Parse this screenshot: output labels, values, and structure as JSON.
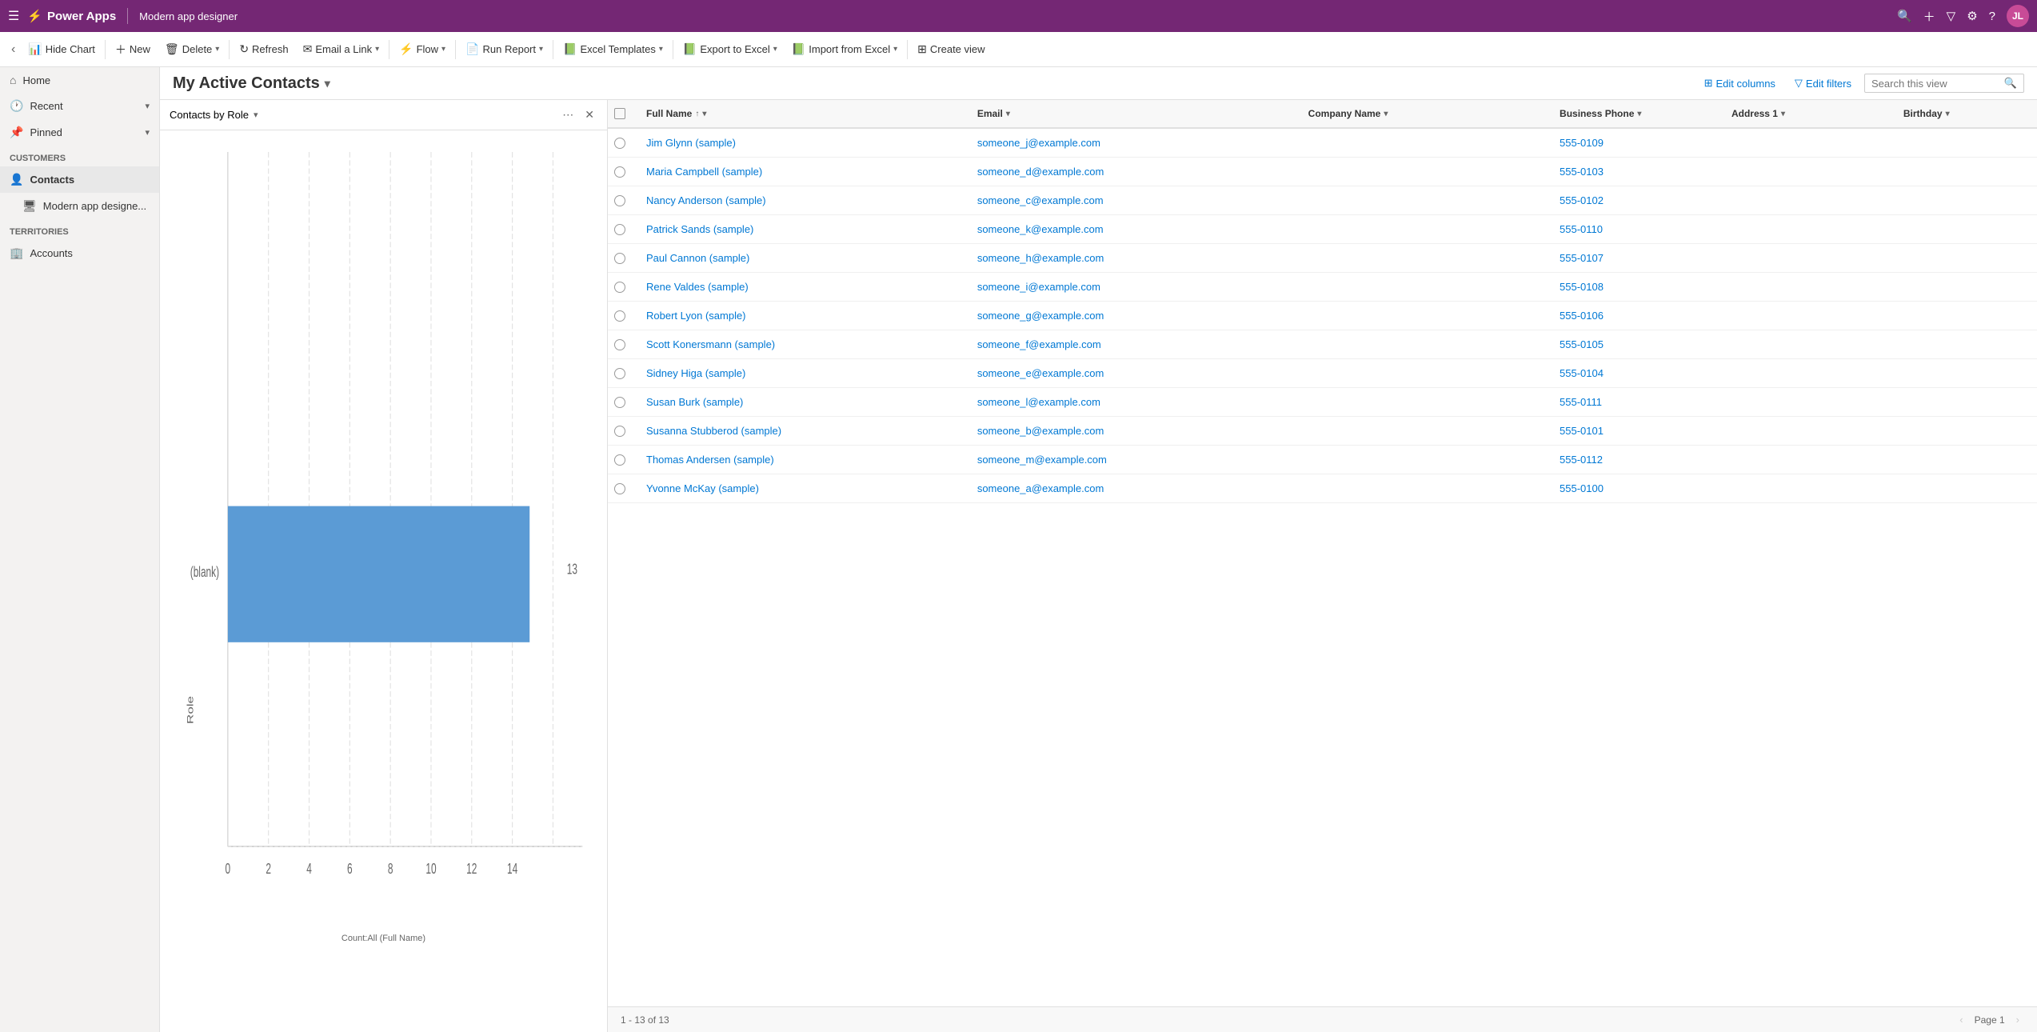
{
  "topbar": {
    "hamburger": "☰",
    "logo_icon": "⚡",
    "logo_text": "Power Apps",
    "app_name": "Modern app designer",
    "icons": [
      "🔍",
      "+",
      "▽",
      "⚙",
      "?"
    ],
    "avatar": "JL"
  },
  "commandbar": {
    "back_arrow": "‹",
    "buttons": [
      {
        "id": "hide-chart",
        "icon": "📊",
        "label": "Hide Chart",
        "has_dropdown": false
      },
      {
        "id": "new",
        "icon": "+",
        "label": "New",
        "has_dropdown": false
      },
      {
        "id": "delete",
        "icon": "🗑",
        "label": "Delete",
        "has_dropdown": true
      },
      {
        "id": "refresh",
        "icon": "↻",
        "label": "Refresh",
        "has_dropdown": false
      },
      {
        "id": "email-link",
        "icon": "✉",
        "label": "Email a Link",
        "has_dropdown": true
      },
      {
        "id": "flow",
        "icon": "⚡",
        "label": "Flow",
        "has_dropdown": true
      },
      {
        "id": "run-report",
        "icon": "📄",
        "label": "Run Report",
        "has_dropdown": true
      },
      {
        "id": "excel-templates",
        "icon": "📗",
        "label": "Excel Templates",
        "has_dropdown": true
      },
      {
        "id": "export-excel",
        "icon": "📗",
        "label": "Export to Excel",
        "has_dropdown": true
      },
      {
        "id": "import-excel",
        "icon": "📗",
        "label": "Import from Excel",
        "has_dropdown": true
      },
      {
        "id": "create-view",
        "icon": "⊞",
        "label": "Create view",
        "has_dropdown": false
      }
    ]
  },
  "view_header": {
    "title": "My Active Contacts",
    "title_dropdown": "▾",
    "edit_columns_label": "Edit columns",
    "edit_filters_label": "Edit filters",
    "search_placeholder": "Search this view",
    "search_icon": "🔍"
  },
  "chart_panel": {
    "title": "Contacts by Role",
    "title_dropdown": "▾",
    "more_icon": "⋯",
    "close_icon": "✕",
    "bar_data": [
      {
        "label": "(blank)",
        "value": 13,
        "color": "#5b9bd5"
      }
    ],
    "x_axis_label": "Count:All (Full Name)",
    "y_axis_label": "Role",
    "x_max": 14,
    "x_ticks": [
      0,
      2,
      4,
      6,
      8,
      10,
      12,
      14
    ]
  },
  "grid": {
    "columns": [
      {
        "id": "checkbox",
        "label": ""
      },
      {
        "id": "fullname",
        "label": "Full Name",
        "sort": "↑"
      },
      {
        "id": "email",
        "label": "Email",
        "sort": "↓"
      },
      {
        "id": "company",
        "label": "Company Name",
        "sort": "↓"
      },
      {
        "id": "phone",
        "label": "Business Phone",
        "sort": "↓"
      },
      {
        "id": "address",
        "label": "Address 1",
        "sort": "↓"
      },
      {
        "id": "birthday",
        "label": "Birthday",
        "sort": "↓"
      }
    ],
    "rows": [
      {
        "fullname": "Jim Glynn (sample)",
        "email": "someone_j@example.com",
        "company": "",
        "phone": "555-0109",
        "address": "",
        "birthday": ""
      },
      {
        "fullname": "Maria Campbell (sample)",
        "email": "someone_d@example.com",
        "company": "",
        "phone": "555-0103",
        "address": "",
        "birthday": ""
      },
      {
        "fullname": "Nancy Anderson (sample)",
        "email": "someone_c@example.com",
        "company": "",
        "phone": "555-0102",
        "address": "",
        "birthday": ""
      },
      {
        "fullname": "Patrick Sands (sample)",
        "email": "someone_k@example.com",
        "company": "",
        "phone": "555-0110",
        "address": "",
        "birthday": ""
      },
      {
        "fullname": "Paul Cannon (sample)",
        "email": "someone_h@example.com",
        "company": "",
        "phone": "555-0107",
        "address": "",
        "birthday": ""
      },
      {
        "fullname": "Rene Valdes (sample)",
        "email": "someone_i@example.com",
        "company": "",
        "phone": "555-0108",
        "address": "",
        "birthday": ""
      },
      {
        "fullname": "Robert Lyon (sample)",
        "email": "someone_g@example.com",
        "company": "",
        "phone": "555-0106",
        "address": "",
        "birthday": ""
      },
      {
        "fullname": "Scott Konersmann (sample)",
        "email": "someone_f@example.com",
        "company": "",
        "phone": "555-0105",
        "address": "",
        "birthday": ""
      },
      {
        "fullname": "Sidney Higa (sample)",
        "email": "someone_e@example.com",
        "company": "",
        "phone": "555-0104",
        "address": "",
        "birthday": ""
      },
      {
        "fullname": "Susan Burk (sample)",
        "email": "someone_l@example.com",
        "company": "",
        "phone": "555-0111",
        "address": "",
        "birthday": ""
      },
      {
        "fullname": "Susanna Stubberod (sample)",
        "email": "someone_b@example.com",
        "company": "",
        "phone": "555-0101",
        "address": "",
        "birthday": ""
      },
      {
        "fullname": "Thomas Andersen (sample)",
        "email": "someone_m@example.com",
        "company": "",
        "phone": "555-0112",
        "address": "",
        "birthday": ""
      },
      {
        "fullname": "Yvonne McKay (sample)",
        "email": "someone_a@example.com",
        "company": "",
        "phone": "555-0100",
        "address": "",
        "birthday": ""
      }
    ],
    "footer": {
      "record_count": "1 - 13 of 13",
      "page_label": "Page 1"
    }
  },
  "sidebar": {
    "sections": [
      {
        "id": "nav",
        "items": [
          {
            "id": "home",
            "icon": "⌂",
            "label": "Home",
            "has_expand": false
          },
          {
            "id": "recent",
            "icon": "🕐",
            "label": "Recent",
            "has_expand": true
          },
          {
            "id": "pinned",
            "icon": "📌",
            "label": "Pinned",
            "has_expand": true
          }
        ]
      },
      {
        "id": "customers",
        "header": "Customers",
        "items": [
          {
            "id": "contacts",
            "icon": "👤",
            "label": "Contacts",
            "active": true
          },
          {
            "id": "modern-app-designer",
            "icon": "🖥",
            "label": "Modern app designe...",
            "active": false
          }
        ]
      },
      {
        "id": "territories",
        "header": "Territories",
        "items": [
          {
            "id": "accounts",
            "icon": "🏢",
            "label": "Accounts",
            "active": false
          }
        ]
      }
    ]
  }
}
